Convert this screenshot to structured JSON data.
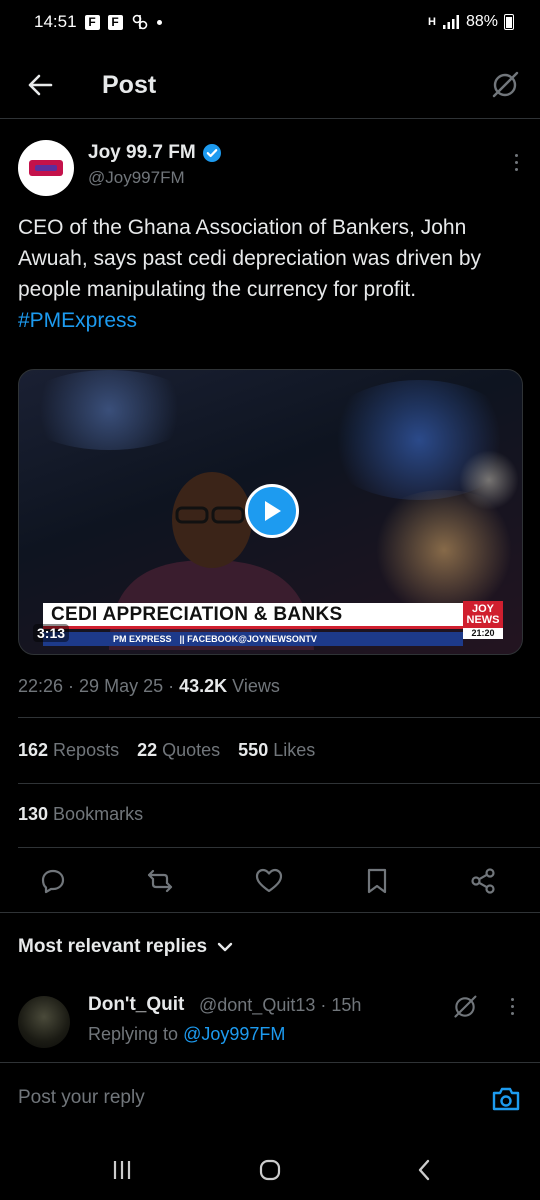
{
  "status_bar": {
    "time": "14:51",
    "notif_icons": [
      "F",
      "F"
    ],
    "network": "H",
    "battery": "88%"
  },
  "header": {
    "title": "Post"
  },
  "tweet": {
    "author_name": "Joy 99.7 FM",
    "author_handle": "@Joy997FM",
    "text_main": "CEO of the Ghana Association of Bankers, John Awuah, says past cedi depreciation was driven by people manipulating the currency for profit. ",
    "hashtag": "#PMExpress",
    "video": {
      "duration": "3:13",
      "lower_third_title": "CEDI APPRECIATION & BANKS",
      "badge_top": "JOY",
      "badge_mid": "NEWS",
      "badge_time": "21:20",
      "ticker_left": "PM EXPRESS",
      "ticker_text": "|| FACEBOOK@JOYNEWSONTV"
    },
    "time": "22:26",
    "date": "29 May 25",
    "views_count": "43.2K",
    "views_label": "Views",
    "reposts_count": "162",
    "reposts_label": "Reposts",
    "quotes_count": "22",
    "quotes_label": "Quotes",
    "likes_count": "550",
    "likes_label": "Likes",
    "bookmarks_count": "130",
    "bookmarks_label": "Bookmarks"
  },
  "replies_section": {
    "sort_label": "Most relevant replies"
  },
  "reply": {
    "name": "Don't_Quit",
    "handle_time": "@dont_Quit13 · 15h",
    "replying_prefix": "Replying to ",
    "replying_mention": "@Joy997FM"
  },
  "compose": {
    "placeholder": "Post your reply"
  },
  "colors": {
    "accent": "#1d9bf0",
    "background": "#000000",
    "muted": "#71767b",
    "text": "#e7e9ea"
  }
}
